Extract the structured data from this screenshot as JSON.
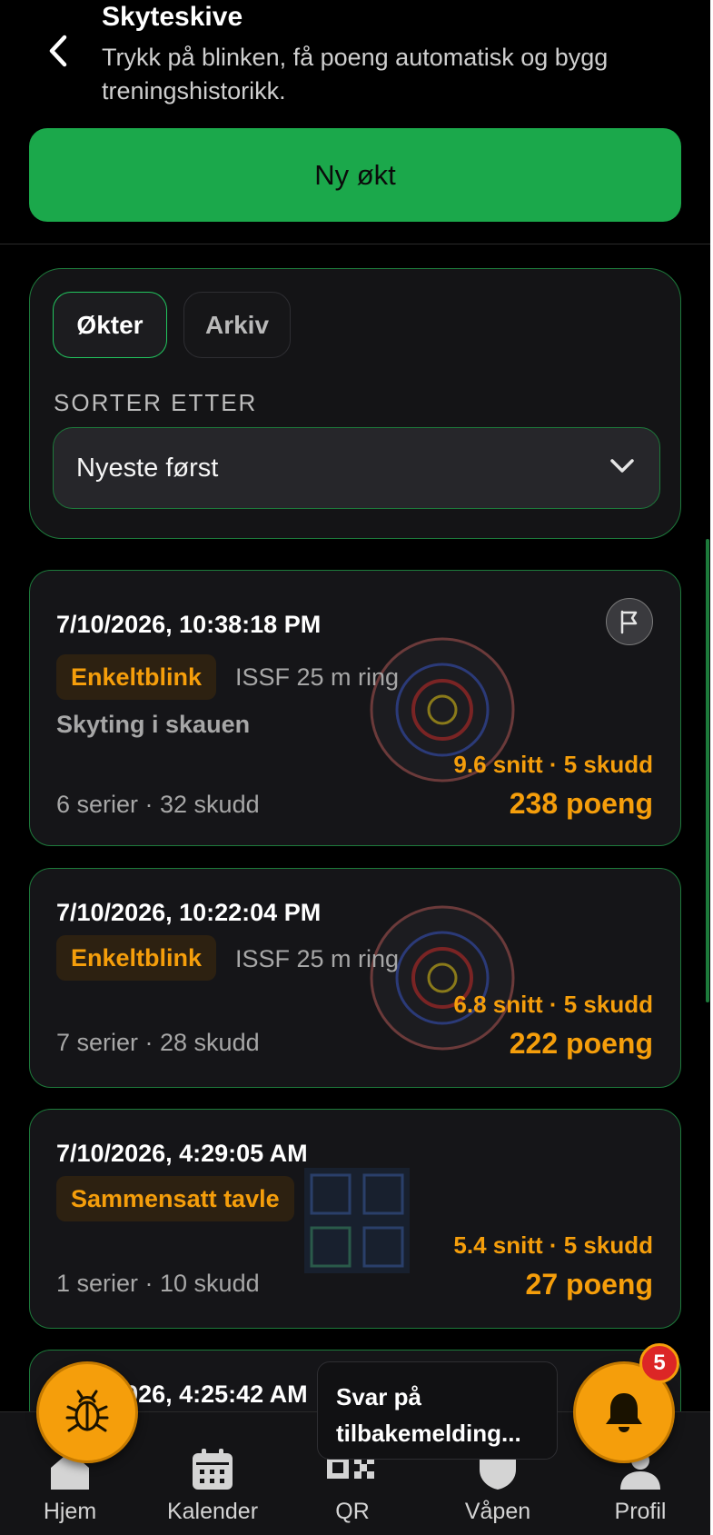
{
  "header": {
    "title": "Skyteskive",
    "subtitle": "Trykk på blinken, få poeng automatisk og bygg treningshistorikk.",
    "new_session_label": "Ny økt"
  },
  "filters": {
    "tabs": [
      {
        "label": "Økter",
        "active": true
      },
      {
        "label": "Arkiv",
        "active": false
      }
    ],
    "sort_label": "SORTER ETTER",
    "sort_value": "Nyeste først"
  },
  "sessions": [
    {
      "date": "7/10/2026, 10:38:18 PM",
      "badge": "Enkeltblink",
      "ring_type": "ISSF 25 m ring",
      "note": "Skyting i skauen",
      "avg": "9.6 snitt · 5 skudd",
      "points": "238 poeng",
      "series": "6 serier · 32 skudd"
    },
    {
      "date": "7/10/2026, 10:22:04 PM",
      "badge": "Enkeltblink",
      "ring_type": "ISSF 25 m ring",
      "avg": "6.8 snitt · 5 skudd",
      "points": "222 poeng",
      "series": "7 serier · 28 skudd"
    },
    {
      "date": "7/10/2026, 4:29:05 AM",
      "badge": "Sammensatt tavle",
      "avg": "5.4 snitt · 5 skudd",
      "points": "27 poeng",
      "series": "1 serier · 10 skudd"
    },
    {
      "date": "7/10/2026, 4:25:42 AM"
    }
  ],
  "toast": "Svar på tilbakemelding...",
  "notification_count": "5",
  "nav": [
    {
      "label": "Hjem",
      "icon": "home-icon"
    },
    {
      "label": "Kalender",
      "icon": "calendar-icon"
    },
    {
      "label": "QR",
      "icon": "qr-icon"
    },
    {
      "label": "Våpen",
      "icon": "shield-icon"
    },
    {
      "label": "Profil",
      "icon": "profile-icon"
    }
  ],
  "colors": {
    "accent_green": "#1ba84b",
    "border_green": "#1d7a3b",
    "accent_orange": "#f59e0b",
    "badge_red": "#dc2626"
  }
}
